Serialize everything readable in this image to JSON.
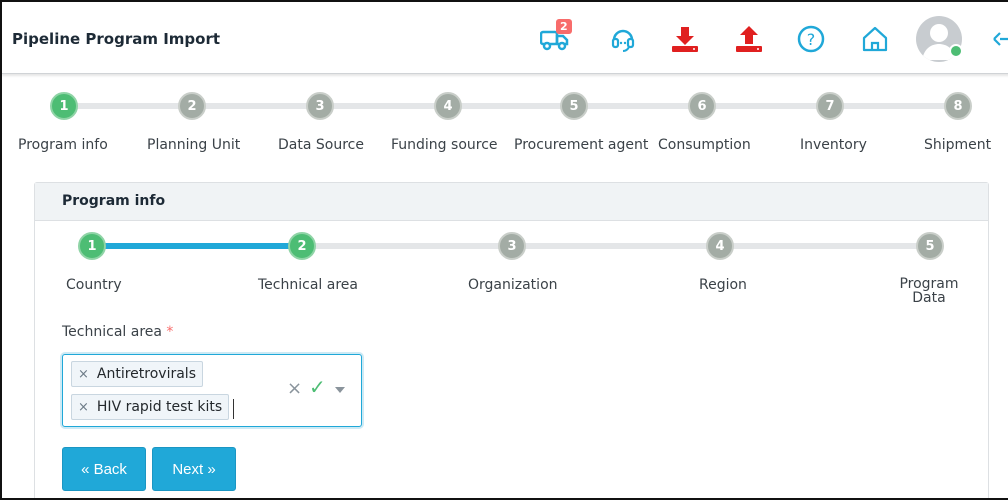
{
  "header": {
    "title": "Pipeline Program Import",
    "notification_count": "2",
    "icons": [
      "truck-icon",
      "headset-icon",
      "download-icon",
      "upload-icon",
      "help-icon",
      "home-icon",
      "avatar",
      "logout-icon"
    ],
    "colors": {
      "download": "#e02020",
      "upload": "#e02020",
      "accent": "#20a8d8"
    }
  },
  "main_steps": [
    {
      "num": "1",
      "label": "Program info",
      "active": true
    },
    {
      "num": "2",
      "label": "Planning Unit",
      "active": false
    },
    {
      "num": "3",
      "label": "Data Source",
      "active": false
    },
    {
      "num": "4",
      "label": "Funding source",
      "active": false
    },
    {
      "num": "5",
      "label": "Procurement agent",
      "active": false
    },
    {
      "num": "6",
      "label": "Consumption",
      "active": false
    },
    {
      "num": "7",
      "label": "Inventory",
      "active": false
    },
    {
      "num": "8",
      "label": "Shipment",
      "active": false
    }
  ],
  "card": {
    "title": "Program info",
    "sub_steps": [
      {
        "num": "1",
        "label": "Country",
        "active": true
      },
      {
        "num": "2",
        "label": "Technical area",
        "active": true
      },
      {
        "num": "3",
        "label": "Organization",
        "active": false
      },
      {
        "num": "4",
        "label": "Region",
        "active": false
      },
      {
        "num": "5",
        "label": "Program Data",
        "active": false
      }
    ],
    "technical_area": {
      "label": "Technical area",
      "required_mark": "*",
      "selected": [
        "Antiretrovirals",
        "HIV rapid test kits"
      ],
      "remove_glyph": "×"
    },
    "back_label": "« Back",
    "next_label": "Next »"
  }
}
